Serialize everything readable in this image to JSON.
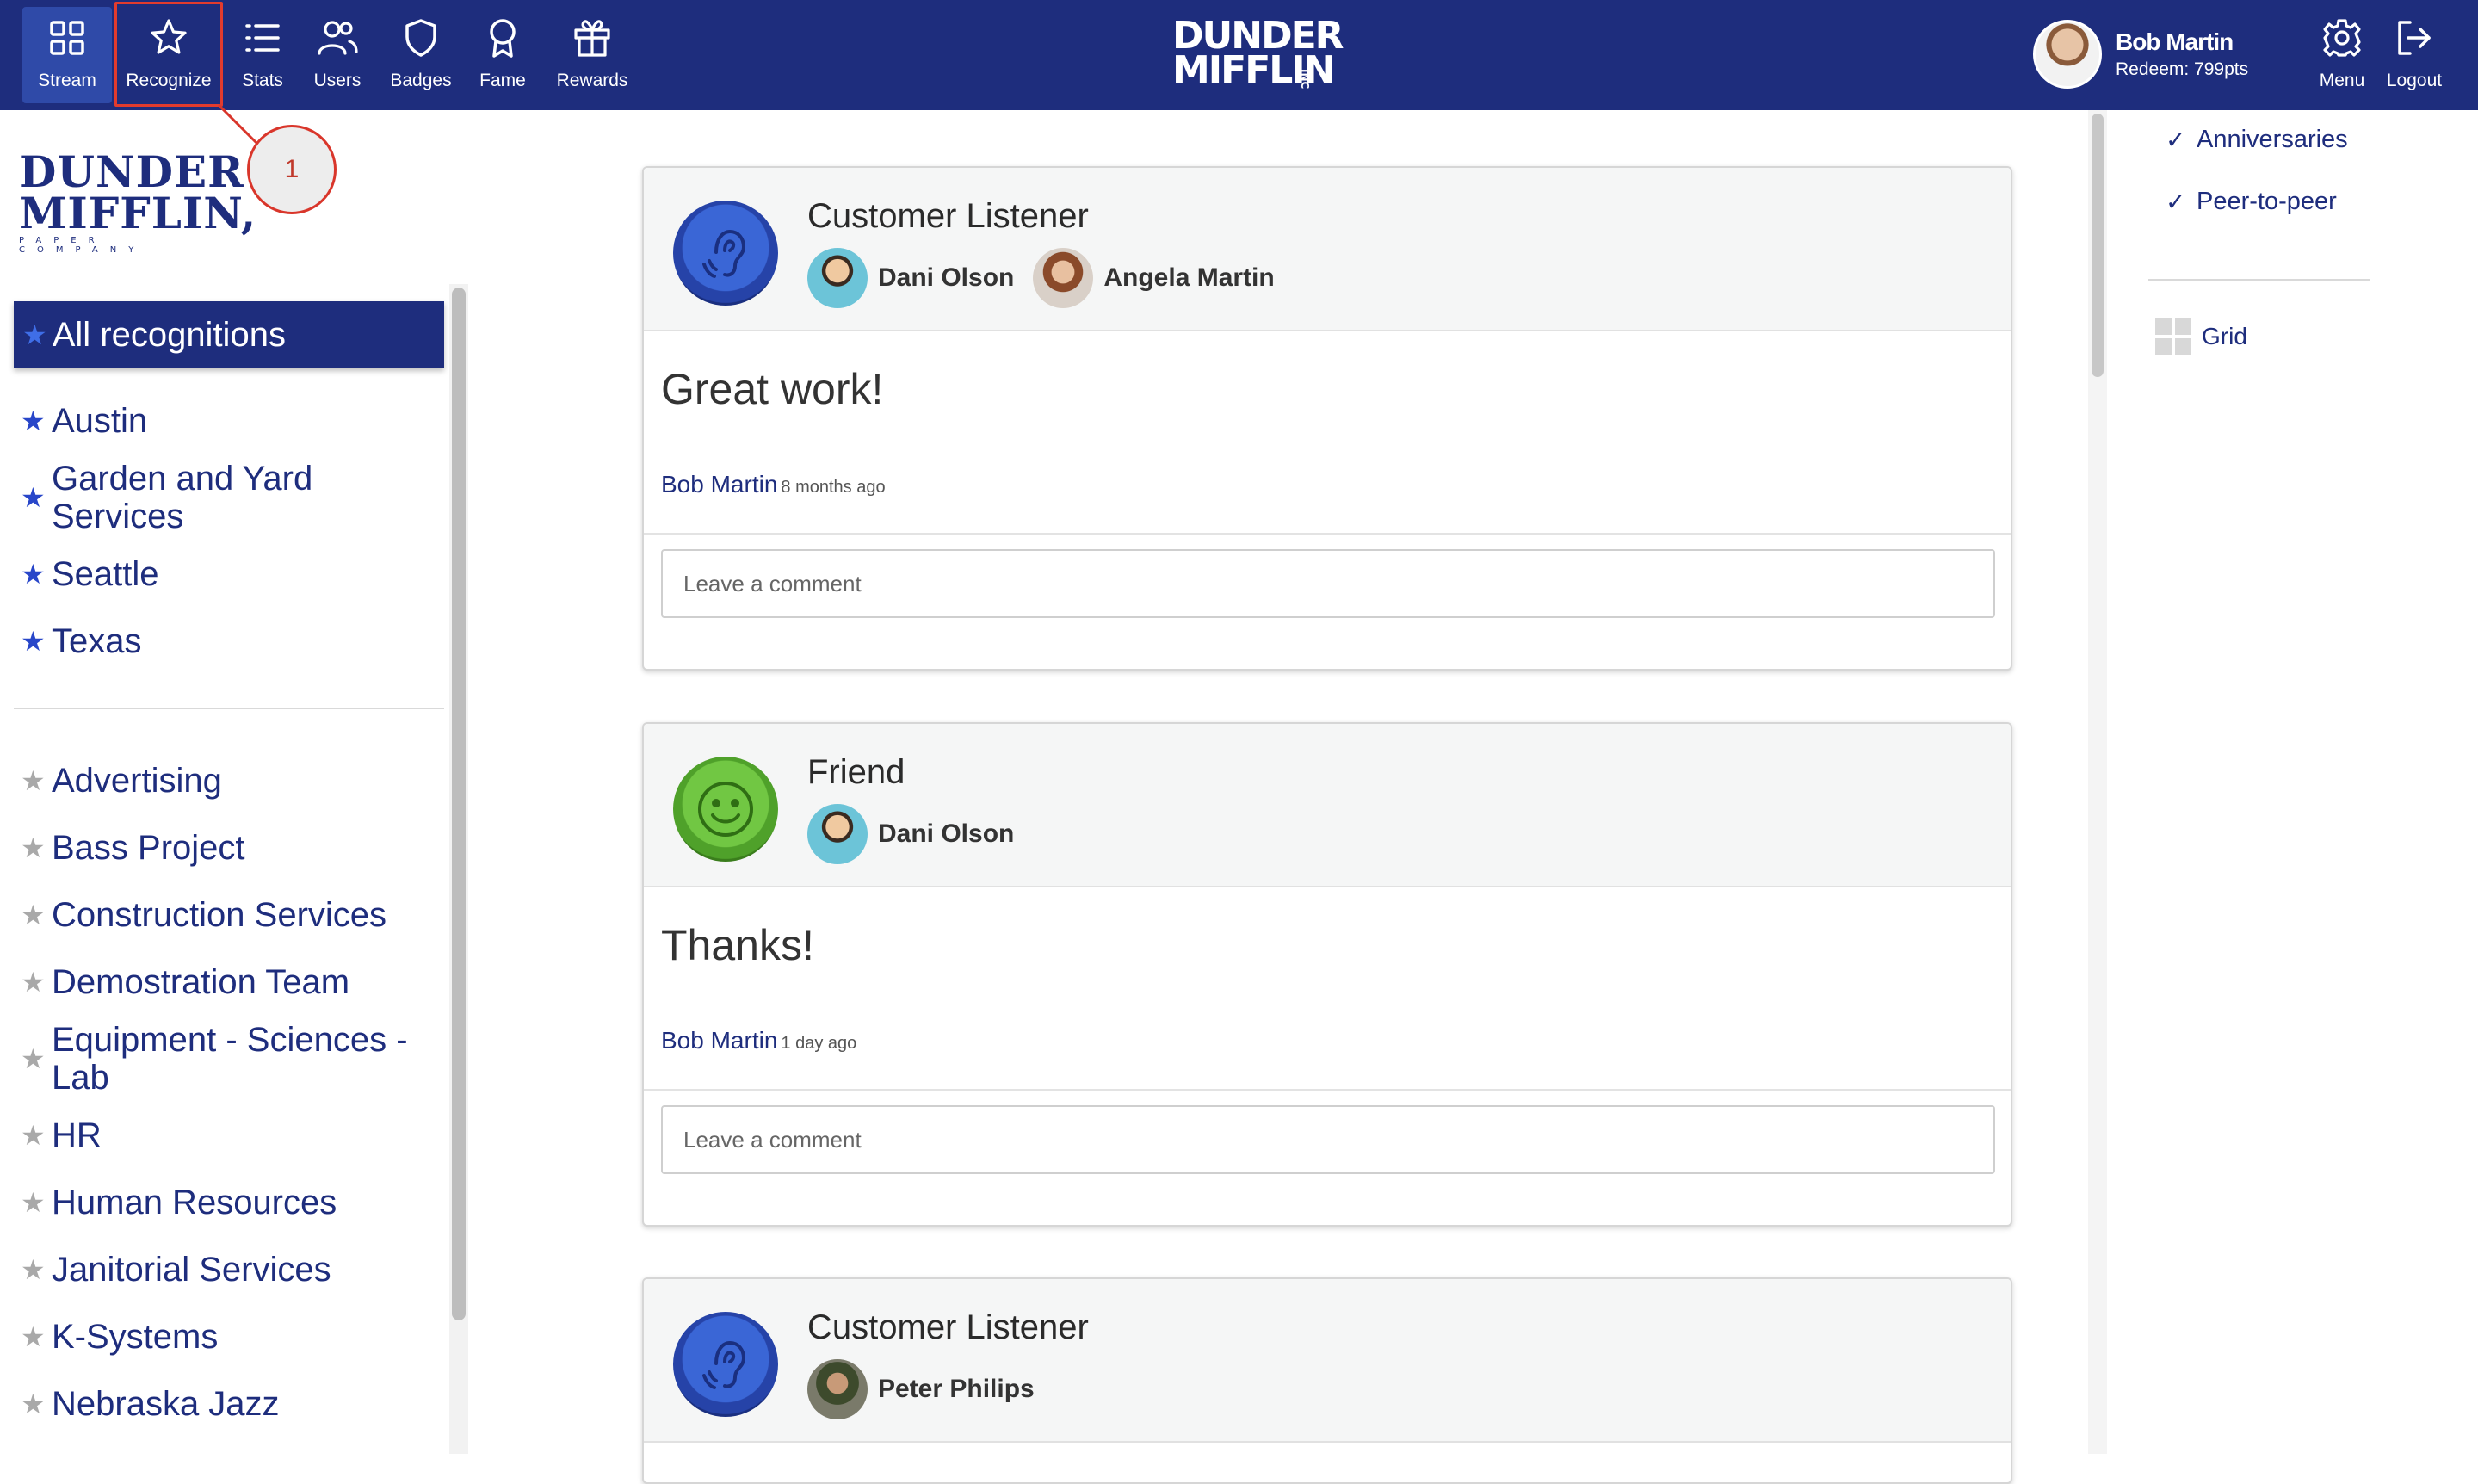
{
  "nav": {
    "items": [
      {
        "label": "Stream",
        "icon": "grid-icon"
      },
      {
        "label": "Recognize",
        "icon": "star-icon"
      },
      {
        "label": "Stats",
        "icon": "list-icon"
      },
      {
        "label": "Users",
        "icon": "users-icon"
      },
      {
        "label": "Badges",
        "icon": "shield-icon"
      },
      {
        "label": "Fame",
        "icon": "award-icon"
      },
      {
        "label": "Rewards",
        "icon": "gift-icon"
      }
    ],
    "menu_label": "Menu",
    "logout_label": "Logout"
  },
  "annotation": {
    "number": "1"
  },
  "logo": {
    "line1": "DUNDER",
    "line2": "MIFFLIN",
    "inc": "INC",
    "left_line1": "DUNDER",
    "left_line2": "MIFFLIN,",
    "left_tagline": "PAPER COMPANY"
  },
  "user": {
    "name": "Bob Martin",
    "points": "Redeem: 799pts"
  },
  "sidebar": {
    "all_label": "All recognitions",
    "locations": [
      "Austin",
      "Garden and Yard Services",
      "Seattle",
      "Texas"
    ],
    "teams": [
      "Advertising",
      "Bass Project",
      "Construction Services",
      "Demostration Team",
      "Equipment - Sciences - Lab",
      "HR",
      "Human Resources",
      "Janitorial Services",
      "K-Systems",
      "Nebraska Jazz"
    ]
  },
  "feed": [
    {
      "badge": "Customer Listener",
      "badge_icon": "ear-icon",
      "badge_color": "#2f55c4",
      "recipients": [
        "Dani Olson",
        "Angela Martin"
      ],
      "message": "Great work!",
      "author": "Bob Martin",
      "time": "8 months ago",
      "comment_placeholder": "Leave a comment"
    },
    {
      "badge": "Friend",
      "badge_icon": "smiley-icon",
      "badge_color": "#5fb535",
      "recipients": [
        "Dani Olson"
      ],
      "message": "Thanks!",
      "author": "Bob Martin",
      "time": "1 day ago",
      "comment_placeholder": "Leave a comment"
    },
    {
      "badge": "Customer Listener",
      "badge_icon": "ear-icon",
      "badge_color": "#2f55c4",
      "recipients": [
        "Peter Philips"
      ]
    }
  ],
  "right_panel": {
    "filters": [
      "Anniversaries",
      "Peer-to-peer"
    ],
    "check_glyph": "✓",
    "view_label": "Grid"
  },
  "colors": {
    "brand": "#1e2d7d",
    "highlight": "#e23b2e"
  }
}
